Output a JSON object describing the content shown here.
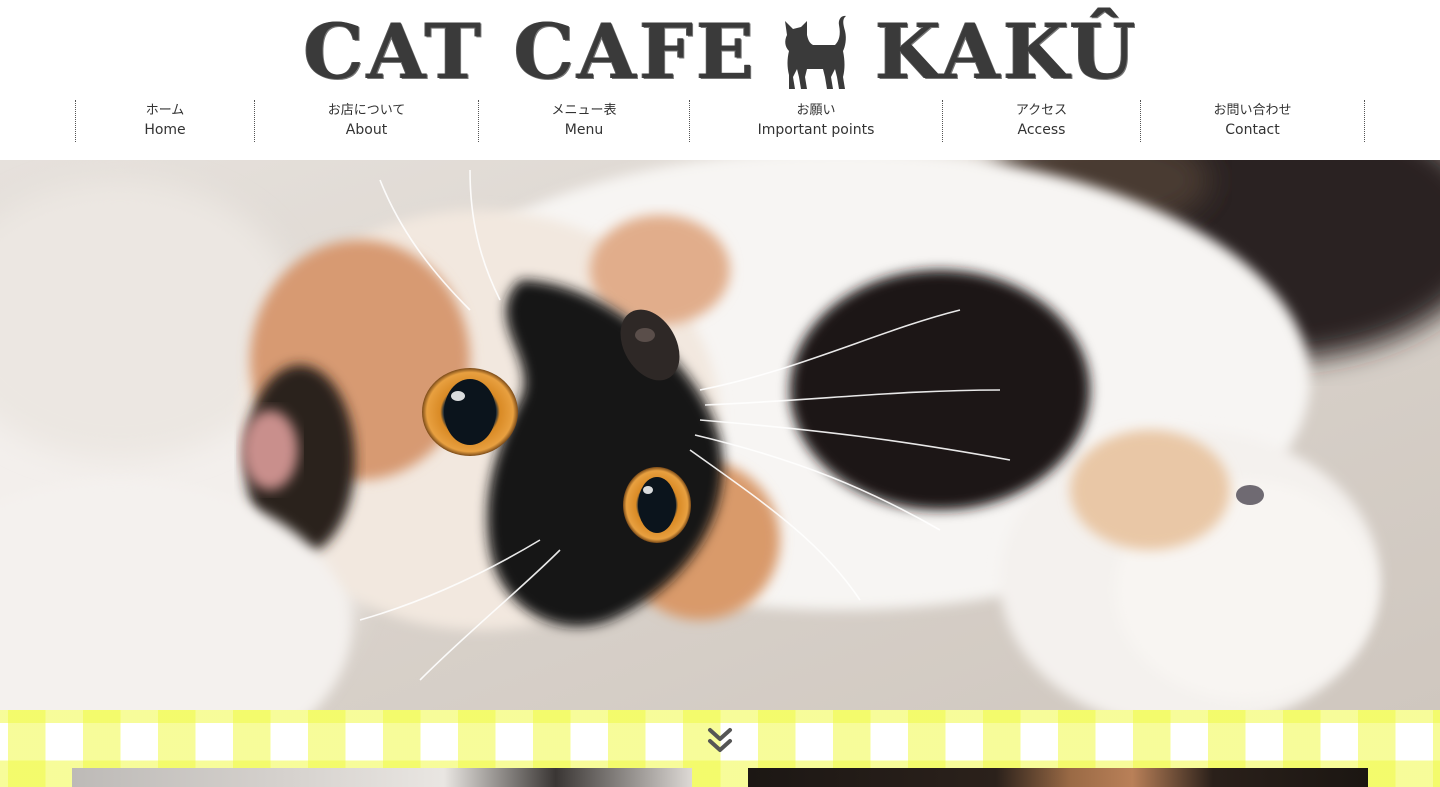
{
  "site": {
    "logo_text_left": "CAT CAFE",
    "logo_text_right": "KAKÛ",
    "logo_icon": "cat-silhouette-icon"
  },
  "nav": {
    "items": [
      {
        "jp": "ホーム",
        "en": "Home"
      },
      {
        "jp": "お店について",
        "en": "About"
      },
      {
        "jp": "メニュー表",
        "en": "Menu"
      },
      {
        "jp": "お願い",
        "en": "Important points"
      },
      {
        "jp": "アクセス",
        "en": "Access"
      },
      {
        "jp": "お問い合わせ",
        "en": "Contact"
      }
    ]
  },
  "hero": {
    "image": "calico-cat-lying-upside-down-photo"
  },
  "band": {
    "pattern": "yellow-gingham",
    "accent_color": "#f2fa46",
    "scroll_icon": "double-chevron-down-icon"
  },
  "colors": {
    "text": "#333333",
    "logo": "#3a3a3a",
    "gingham": "#f2fa46"
  }
}
